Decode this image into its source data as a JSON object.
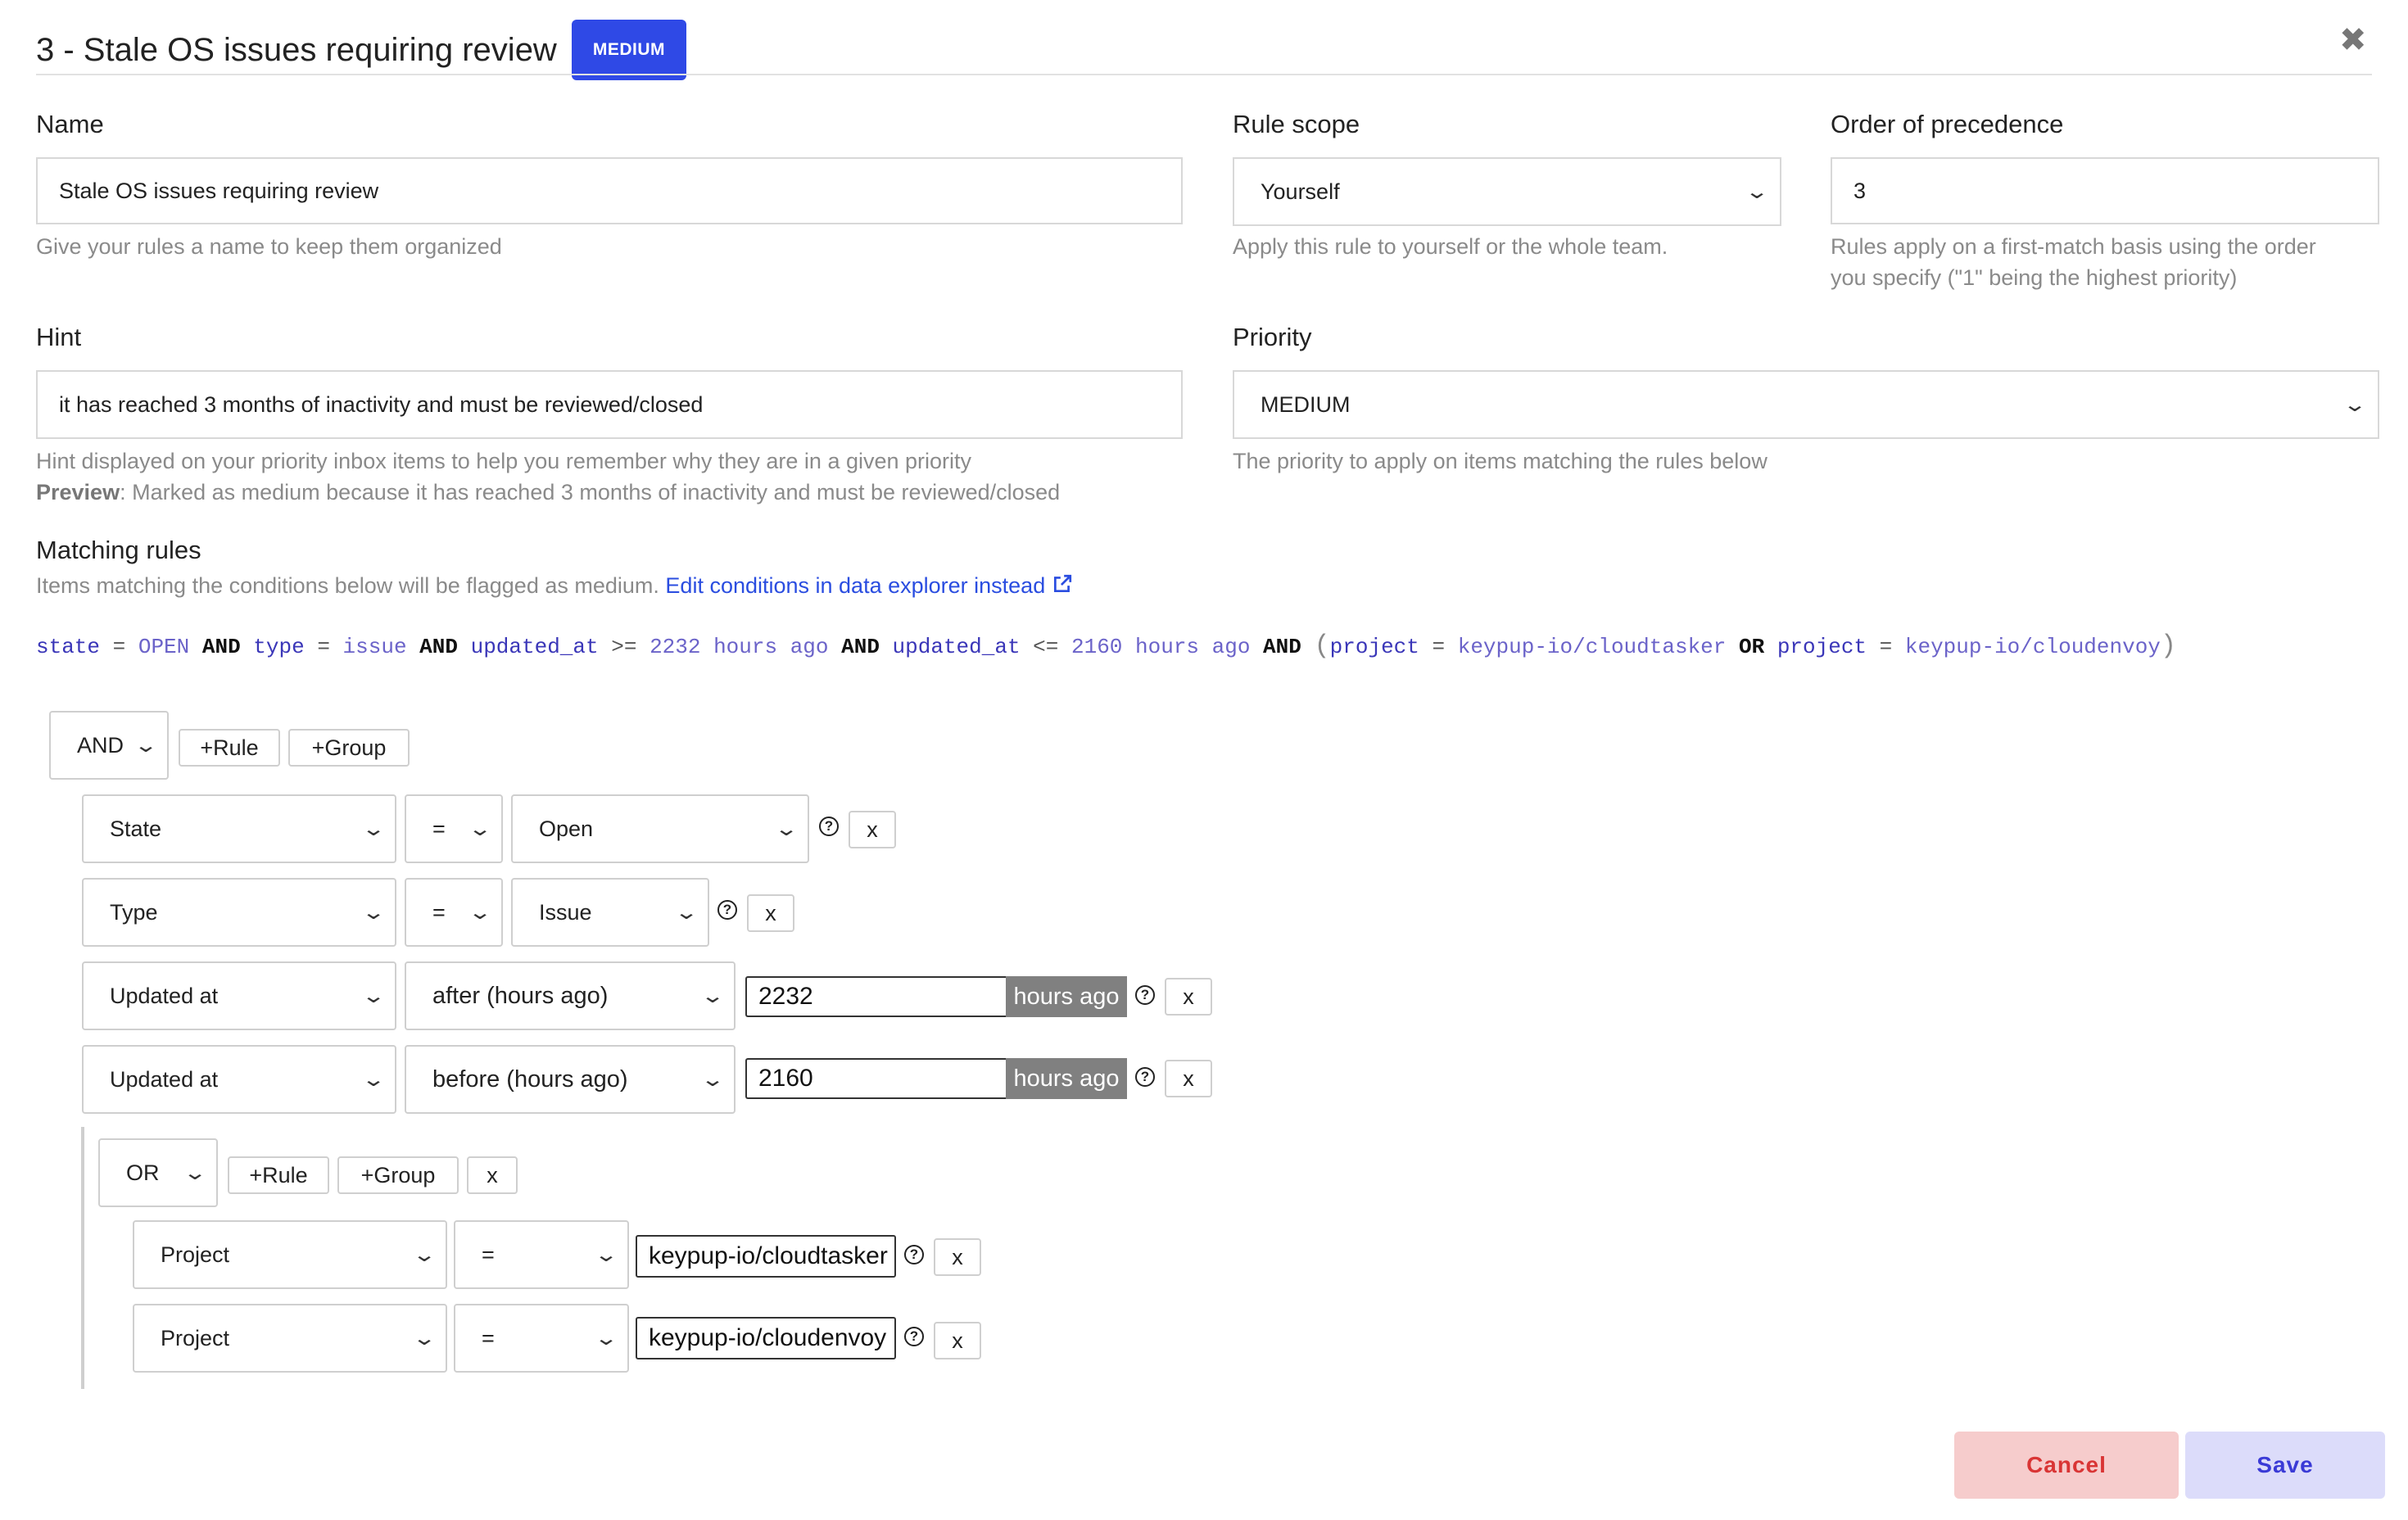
{
  "header": {
    "title": "3 - Stale OS issues requiring review",
    "badge": "MEDIUM",
    "close_icon": "close-icon"
  },
  "form": {
    "name": {
      "label": "Name",
      "value": "Stale OS issues requiring review",
      "help": "Give your rules a name to keep them organized"
    },
    "rule_scope": {
      "label": "Rule scope",
      "value": "Yourself",
      "help": "Apply this rule to yourself or the whole team."
    },
    "order": {
      "label": "Order of precedence",
      "value": "3",
      "help_line1": "Rules apply on a first-match basis using the order",
      "help_line2": "you specify (\"1\" being the highest priority)"
    },
    "hint": {
      "label": "Hint",
      "value": "it has reached 3 months of inactivity and must be reviewed/closed",
      "help": "Hint displayed on your priority inbox items to help you remember why they are in a given priority",
      "preview_label": "Preview",
      "preview_text": ": Marked as medium because it has reached 3 months of inactivity and must be reviewed/closed"
    },
    "priority": {
      "label": "Priority",
      "value": "MEDIUM",
      "help": "The priority to apply on items matching the rules below"
    }
  },
  "matching": {
    "title": "Matching rules",
    "description": "Items matching the conditions below will be flagged as medium.",
    "link": "Edit conditions in data explorer instead",
    "link_icon": "external-link-icon"
  },
  "query": {
    "f_state": "state",
    "eq": "=",
    "v_open": "OPEN",
    "and": "AND",
    "f_type": "type",
    "v_issue": "issue",
    "f_updated": "updated_at",
    "gte": ">=",
    "v_2232": "2232 hours ago",
    "lte": "<=",
    "v_2160": "2160 hours ago",
    "lparen": "(",
    "rparen": ")",
    "f_project": "project",
    "v_cloudtasker": "keypup-io/cloudtasker",
    "or": "OR",
    "v_cloudenvoy": "keypup-io/cloudenvoy"
  },
  "builder": {
    "root_combinator": "AND",
    "add_rule": "+Rule",
    "add_group": "+Group",
    "remove": "x",
    "help_icon": "question-circle-icon",
    "hours_ago": "hours ago",
    "rules": [
      {
        "field": "State",
        "operator": "=",
        "value": "Open"
      },
      {
        "field": "Type",
        "operator": "=",
        "value": "Issue"
      },
      {
        "field": "Updated at",
        "operator": "after (hours ago)",
        "value": "2232"
      },
      {
        "field": "Updated at",
        "operator": "before (hours ago)",
        "value": "2160"
      }
    ],
    "group": {
      "combinator": "OR",
      "rules": [
        {
          "field": "Project",
          "operator": "=",
          "value": "keypup-io/cloudtasker"
        },
        {
          "field": "Project",
          "operator": "=",
          "value": "keypup-io/cloudenvoy"
        }
      ]
    }
  },
  "footer": {
    "cancel": "Cancel",
    "save": "Save"
  },
  "colors": {
    "accent": "#2f49e6",
    "link": "#2a4de0",
    "cancel_bg": "#f6cccc",
    "cancel_text": "#d93535",
    "save_bg": "#dcdcfa",
    "save_text": "#3a3ad6"
  }
}
